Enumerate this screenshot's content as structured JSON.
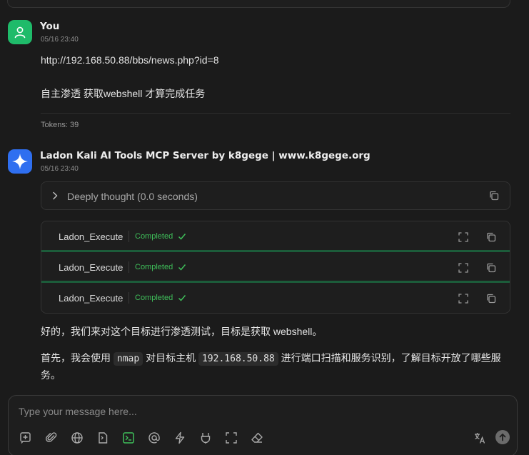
{
  "user_message": {
    "name": "You",
    "time": "05/16 23:40",
    "url": "http://192.168.50.88/bbs/news.php?id=8",
    "task": "自主渗透 获取webshell 才算完成任务",
    "tokens": "Tokens: 39"
  },
  "assistant_message": {
    "name": "Ladon Kali AI Tools MCP Server by k8gege | www.k8gege.org",
    "time": "05/16 23:40",
    "thought_label": "Deeply thought (0.0 seconds)",
    "tools": [
      {
        "name": "Ladon_Execute",
        "status": "Completed"
      },
      {
        "name": "Ladon_Execute",
        "status": "Completed"
      },
      {
        "name": "Ladon_Execute",
        "status": "Completed"
      }
    ],
    "para1": "好的，我们来对这个目标进行渗透测试，目标是获取 webshell。",
    "para2_a": "首先，我会使用 ",
    "para2_code1": "nmap",
    "para2_b": " 对目标主机 ",
    "para2_code2": "192.168.50.88",
    "para2_c": " 进行端口扫描和服务识别，了解目标开放了哪些服务。"
  },
  "composer": {
    "placeholder": "Type your message here...",
    "toolbar_icons": [
      "new-topic-icon",
      "attachment-icon",
      "web-search-icon",
      "knowledge-icon",
      "mcp-terminal-icon",
      "mention-icon",
      "quick-phrase-icon",
      "clear-context-icon",
      "fullscreen-icon",
      "eraser-icon"
    ],
    "active_icon": "mcp-terminal-icon"
  },
  "colors": {
    "background": "#1b1b1b",
    "user_avatar": "#1fbb6a",
    "bot_avatar": "#2f6ff0",
    "completed": "#3fbf5a"
  }
}
